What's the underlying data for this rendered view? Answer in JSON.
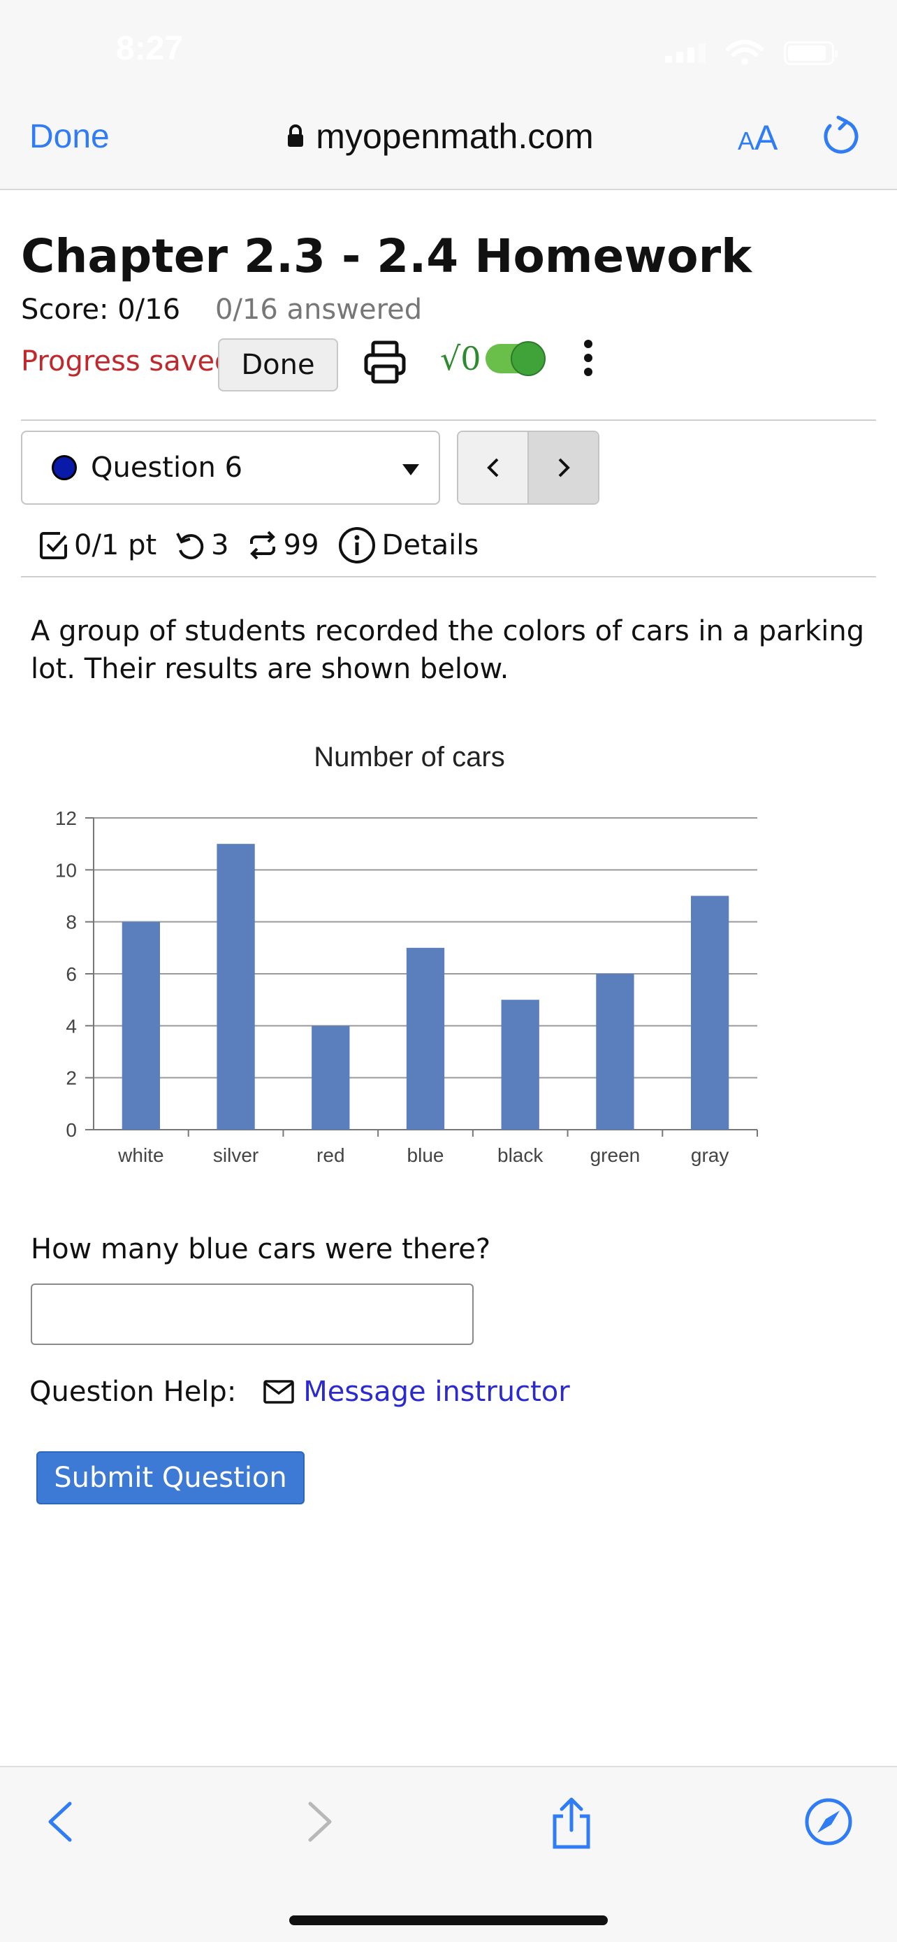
{
  "status_bar": {
    "time": "8:27"
  },
  "browser": {
    "done_label": "Done",
    "url": "myopenmath.com",
    "text_size_small": "A",
    "text_size_big": "A"
  },
  "page": {
    "title": "Chapter 2.3 - 2.4 Homework",
    "score": "Score: 0/16",
    "answered": "0/16 answered",
    "progress_saved": "Progress saved",
    "done_button": "Done",
    "sqrt_label": "√0",
    "toggle_on": true
  },
  "question_nav": {
    "selected": "Question 6",
    "prev_label": "<",
    "next_label": ">"
  },
  "meta": {
    "points": "0/1 pt",
    "retries": "3",
    "attempts": "99",
    "details": "Details"
  },
  "prompt": "A group of students recorded the colors of cars in a parking lot. Their results are shown below.",
  "chart_data": {
    "type": "bar",
    "title": "Number of cars",
    "categories": [
      "white",
      "silver",
      "red",
      "blue",
      "black",
      "green",
      "gray"
    ],
    "values": [
      8,
      11,
      4,
      7,
      5,
      6,
      9
    ],
    "xlabel": "",
    "ylabel": "",
    "ylim": [
      0,
      12
    ],
    "yticks": [
      0,
      2,
      4,
      6,
      8,
      10,
      12
    ],
    "grid": true,
    "bar_color": "#5b7fbc"
  },
  "question": {
    "text": "How many blue cars were there?",
    "answer_value": ""
  },
  "help": {
    "label": "Question Help:",
    "message_link": "Message instructor"
  },
  "submit_label": "Submit Question"
}
